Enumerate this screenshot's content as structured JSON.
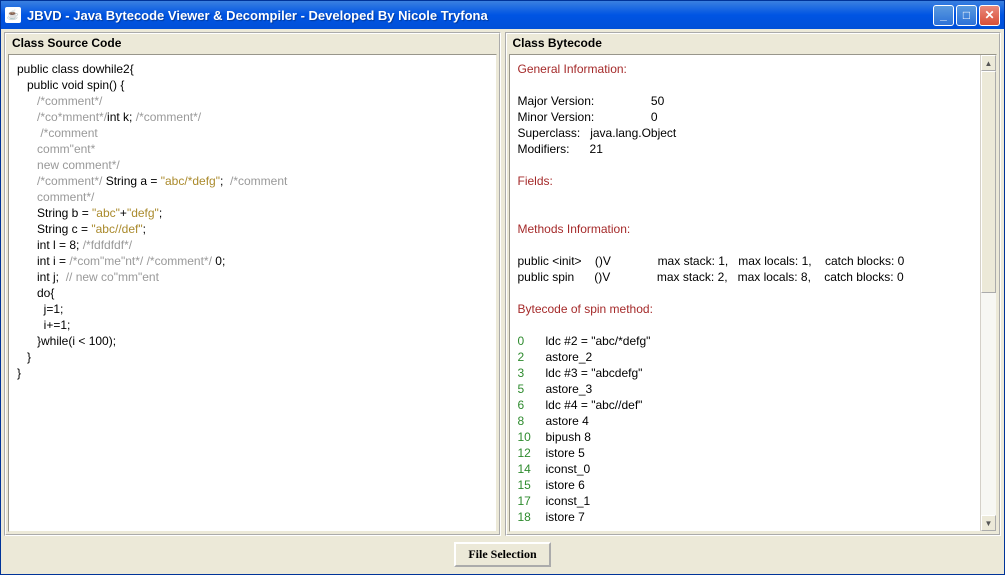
{
  "window": {
    "title": "JBVD  -  Java Bytecode Viewer & Decompiler  -  Developed By Nicole Tryfona"
  },
  "panels": {
    "left_title": "Class Source Code",
    "right_title": "Class Bytecode"
  },
  "source": {
    "l1": "public class dowhile2{",
    "l2": "   public void spin() {",
    "l3a": "      ",
    "l3c": "/*comment*/",
    "l4a": "      ",
    "l4c1": "/*co*mment*/",
    "l4t": "int k; ",
    "l4c2": "/*comment*/",
    "l5a": "       ",
    "l5c": "/*comment",
    "l6a": "      ",
    "l6c": "comm\"ent*",
    "l7a": "      ",
    "l7c": "new comment*/",
    "l8a": "      ",
    "l8c1": "/*comment*/",
    "l8t": " String a = ",
    "l8s": "\"abc/*defg\"",
    "l8t2": ";  ",
    "l8c2": "/*comment",
    "l9a": "      ",
    "l9c": "comment*/",
    "l10a": "      String b = ",
    "l10s1": "\"abc\"",
    "l10p": "+",
    "l10s2": "\"defg\"",
    "l10e": ";",
    "l11a": "      String c = ",
    "l11s": "\"abc//def\"",
    "l11e": ";",
    "l12a": "      int l = 8; ",
    "l12c": "/*fdfdfdf*/",
    "l13a": "      int i = ",
    "l13c": "/*com\"me\"nt*/ /*comment*/",
    "l13e": " 0;",
    "l14a": "      int j;  ",
    "l14c": "// new co\"mm\"ent",
    "l15": "      do{",
    "l16": "        j=1;",
    "l17": "        i+=1;",
    "l18": "      }while(i < 100);",
    "l19": "   }",
    "l20": "}"
  },
  "bytecode": {
    "h1": "General Information:",
    "major_l": "Major Version:",
    "major_v": "50",
    "minor_l": "Minor Version:",
    "minor_v": "0",
    "super_l": "Superclass:",
    "super_v": "java.lang.Object",
    "mod_l": "Modifiers:",
    "mod_v": "21",
    "h2": "Fields:",
    "h3": "Methods Information:",
    "m1a": "public <init>    ()V",
    "m1b": "max stack: 1,   max locals: 1,    catch blocks: 0",
    "m2a": "public spin      ()V",
    "m2b": "max stack: 2,   max locals: 8,    catch blocks: 0",
    "h4": "Bytecode of spin method:",
    "b0n": "0",
    "b0": "ldc #2 = \"abc/*defg\"",
    "b2n": "2",
    "b2": "astore_2",
    "b3n": "3",
    "b3": "ldc #3 = \"abcdefg\"",
    "b5n": "5",
    "b5": "astore_3",
    "b6n": "6",
    "b6": "ldc #4 = \"abc//def\"",
    "b8n": "8",
    "b8": "astore 4",
    "b10n": "10",
    "b10": "bipush 8",
    "b12n": "12",
    "b12": "istore 5",
    "b14n": "14",
    "b14": "iconst_0",
    "b15n": "15",
    "b15": "istore 6",
    "b17n": "17",
    "b17": "iconst_1",
    "b18n": "18",
    "b18": "istore 7"
  },
  "footer": {
    "button": "File Selection"
  }
}
